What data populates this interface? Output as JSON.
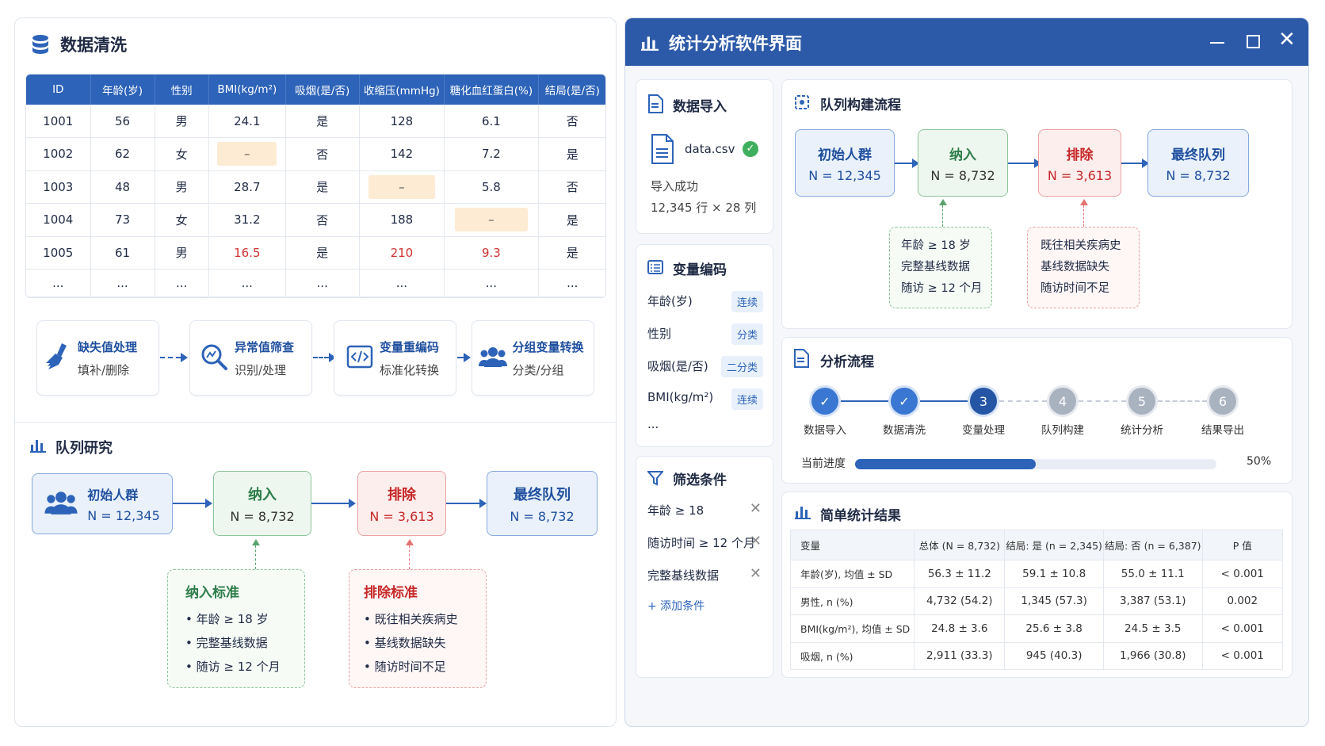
{
  "cleaning": {
    "title": "数据清洗",
    "table": {
      "headers": [
        "ID",
        "年龄(岁)",
        "性别",
        "BMI(kg/m²)",
        "吸烟(是/否)",
        "收缩压(mmHg)",
        "糖化血红蛋白(%)",
        "结局(是/否)"
      ],
      "rows": [
        [
          "1001",
          "56",
          "男",
          "24.1",
          "是",
          "128",
          "6.1",
          "否"
        ],
        [
          "1002",
          "62",
          "女",
          "–",
          "否",
          "142",
          "7.2",
          "是"
        ],
        [
          "1003",
          "48",
          "男",
          "28.7",
          "是",
          "–",
          "5.8",
          "否"
        ],
        [
          "1004",
          "73",
          "女",
          "31.2",
          "否",
          "188",
          "–",
          "是"
        ],
        [
          "1005",
          "61",
          "男",
          "16.5",
          "是",
          "210",
          "9.3",
          "是"
        ],
        [
          "...",
          "...",
          "...",
          "...",
          "...",
          "...",
          "...",
          "..."
        ]
      ]
    },
    "steps": [
      {
        "title": "缺失值处理",
        "sub": "填补/删除",
        "icon": "broom-icon"
      },
      {
        "title": "异常值筛查",
        "sub": "识别/处理",
        "icon": "magnifier-icon"
      },
      {
        "title": "变量重编码",
        "sub": "标准化转换",
        "icon": "code-icon"
      },
      {
        "title": "分组变量转换",
        "sub": "分类/分组",
        "icon": "users-icon"
      }
    ]
  },
  "cohort": {
    "title": "队列研究",
    "boxes": [
      {
        "title": "初始人群",
        "n": "N = 12,345"
      },
      {
        "title": "纳入",
        "n": "N = 8,732"
      },
      {
        "title": "排除",
        "n": "N = 3,613"
      },
      {
        "title": "最终队列",
        "n": "N = 8,732"
      }
    ],
    "inclusion": {
      "title": "纳入标准",
      "items": [
        "年龄 ≥ 18 岁",
        "完整基线数据",
        "随访 ≥ 12 个月"
      ]
    },
    "exclusion": {
      "title": "排除标准",
      "items": [
        "既往相关疾病史",
        "基线数据缺失",
        "随访时间不足"
      ]
    }
  },
  "window": {
    "title": "统计分析软件界面",
    "import": {
      "title": "数据导入",
      "file": "data.csv",
      "status": "导入成功",
      "dims": "12,345 行 × 28 列"
    },
    "coding": {
      "title": "变量编码",
      "items": [
        {
          "name": "年龄(岁)",
          "type": "连续"
        },
        {
          "name": "性别",
          "type": "分类"
        },
        {
          "name": "吸烟(是/否)",
          "type": "二分类"
        },
        {
          "name": "BMI(kg/m²)",
          "type": "连续"
        }
      ],
      "more": "..."
    },
    "filter": {
      "title": "筛选条件",
      "items": [
        "年龄 ≥ 18",
        "随访时间 ≥ 12 个月",
        "完整基线数据"
      ],
      "add": "+ 添加条件"
    },
    "cohort_flow": {
      "title": "队列构建流程",
      "boxes": [
        {
          "title": "初始人群",
          "n": "N = 12,345"
        },
        {
          "title": "纳入",
          "n": "N = 8,732"
        },
        {
          "title": "排除",
          "n": "N = 3,613"
        },
        {
          "title": "最终队列",
          "n": "N = 8,732"
        }
      ],
      "inclusion": [
        "年龄 ≥ 18 岁",
        "完整基线数据",
        "随访 ≥ 12 个月"
      ],
      "exclusion": [
        "既往相关疾病史",
        "基线数据缺失",
        "随访时间不足"
      ]
    },
    "analysis": {
      "title": "分析流程",
      "steps": [
        {
          "num": "✓",
          "label": "数据导入",
          "state": "done"
        },
        {
          "num": "✓",
          "label": "数据清洗",
          "state": "done"
        },
        {
          "num": "3",
          "label": "变量处理",
          "state": "current"
        },
        {
          "num": "4",
          "label": "队列构建",
          "state": "todo"
        },
        {
          "num": "5",
          "label": "统计分析",
          "state": "todo"
        },
        {
          "num": "6",
          "label": "结果导出",
          "state": "todo"
        }
      ],
      "progress_label": "当前进度",
      "progress": 0.5,
      "progress_text": "50%"
    },
    "results": {
      "title": "简单统计结果",
      "headers": [
        "变量",
        "总体 (N = 8,732)",
        "结局: 是 (n = 2,345)",
        "结局: 否 (n = 6,387)",
        "P 值"
      ],
      "rows": [
        [
          "年龄(岁), 均值 ± SD",
          "56.3 ± 11.2",
          "59.1 ± 10.8",
          "55.0 ± 11.1",
          "< 0.001"
        ],
        [
          "男性, n (%)",
          "4,732 (54.2)",
          "1,345 (57.3)",
          "3,387 (53.1)",
          "0.002"
        ],
        [
          "BMI(kg/m²), 均值 ± SD",
          "24.8 ± 3.6",
          "25.6 ± 3.8",
          "24.5 ± 3.5",
          "< 0.001"
        ],
        [
          "吸烟, n (%)",
          "2,911 (33.3)",
          "945 (40.3)",
          "1,966 (30.8)",
          "< 0.001"
        ]
      ]
    }
  },
  "colors": {
    "primary": "#2d63b8",
    "titlebar": "#2d5aa8",
    "green": "#8bc49a",
    "red": "#d03030"
  }
}
